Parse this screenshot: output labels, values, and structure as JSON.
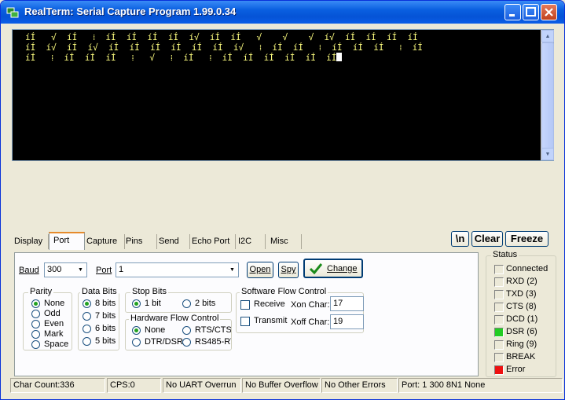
{
  "window": {
    "title": "RealTerm: Serial Capture Program 1.99.0.34",
    "accent": "#0a5fe0"
  },
  "terminal": {
    "lines": [
      "íÍ   √  íÍ   ⁞  íÍ  íÍ  íÍ  íÍ  í√  íÍ  íÍ   √    √    √  í√  íÍ  íÍ  íÍ  íÍ",
      "íÍ  í√  íÍ  í√  íÍ  íÍ  íÍ  íÍ  íÍ  íÍ  í√   ⁞  íÍ  íÍ   ⁞  íÍ  íÍ  íÍ   ⁞  íÍ",
      "íÍ   ⁞  íÍ  íÍ  íÍ   ⁞   √   ⁞  íÍ   ⁞  íÍ  íÍ  íÍ  íÍ  íÍ  íÍ"
    ],
    "text_color": "#ffff80"
  },
  "tabs": [
    "Display",
    "Port",
    "Capture",
    "Pins",
    "Send",
    "Echo Port",
    "I2C",
    "Misc"
  ],
  "active_tab": "Port",
  "actions": {
    "newline": "\\n",
    "clear": "Clear",
    "freeze": "Freeze"
  },
  "port": {
    "baud_label": "Baud",
    "baud_value": "300",
    "port_label": "Port",
    "port_value": "1",
    "open": "Open",
    "spy": "Spy",
    "change": "Change"
  },
  "parity": {
    "title": "Parity",
    "options": [
      "None",
      "Odd",
      "Even",
      "Mark",
      "Space"
    ],
    "selected": "None"
  },
  "data_bits": {
    "title": "Data Bits",
    "options": [
      "8 bits",
      "7 bits",
      "6 bits",
      "5 bits"
    ],
    "selected": "8 bits"
  },
  "stop_bits": {
    "title": "Stop Bits",
    "options": [
      "1 bit",
      "2 bits"
    ],
    "selected": "1 bit"
  },
  "hw_flow": {
    "title": "Hardware Flow Control",
    "options": [
      "None",
      "RTS/CTS",
      "DTR/DSR",
      "RS485-RTS"
    ],
    "selected": "None"
  },
  "sw_flow": {
    "title": "Software Flow Control",
    "receive": "Receive",
    "transmit": "Transmit",
    "xon_label": "Xon Char:",
    "xon_value": "17",
    "xoff_label": "Xoff Char:",
    "xoff_value": "19"
  },
  "status": {
    "title": "Status",
    "items": [
      {
        "label": "Connected",
        "color": "#ece9d8"
      },
      {
        "label": "RXD (2)",
        "color": "#ece9d8"
      },
      {
        "label": "TXD (3)",
        "color": "#ece9d8"
      },
      {
        "label": "CTS (8)",
        "color": "#ece9d8"
      },
      {
        "label": "DCD (1)",
        "color": "#ece9d8"
      },
      {
        "label": "DSR (6)",
        "color": "#22cc22"
      },
      {
        "label": "Ring (9)",
        "color": "#ece9d8"
      },
      {
        "label": "BREAK",
        "color": "#ece9d8"
      },
      {
        "label": "Error",
        "color": "#ee1111"
      }
    ]
  },
  "statusbar": {
    "char_count": "Char Count:336",
    "cps": "CPS:0",
    "uart": "No UART Overrun",
    "buffer": "No Buffer Overflow",
    "errors": "No Other Errors",
    "port": "Port: 1 300 8N1 None"
  }
}
